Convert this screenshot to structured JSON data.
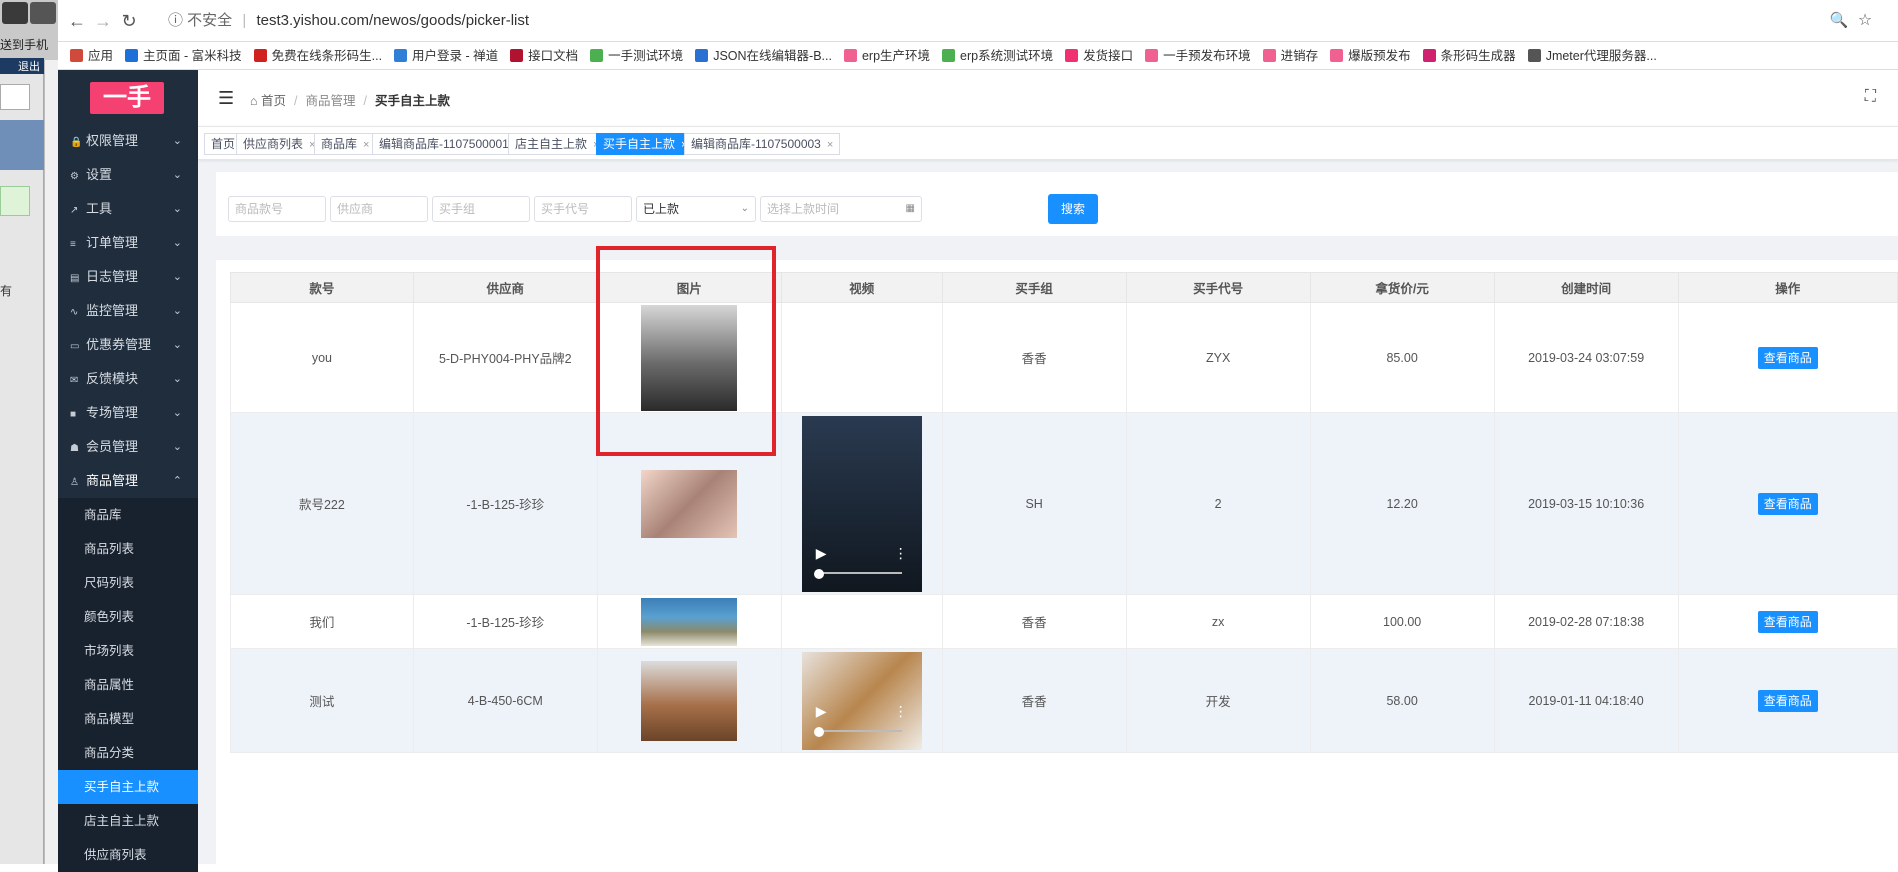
{
  "desktop": {
    "send_text": "送到手机",
    "logout": "退出",
    "side_text": "有"
  },
  "browser": {
    "insecure": "不安全",
    "url": "test3.yishou.com/newos/goods/picker-list",
    "bookmarks": [
      {
        "label": "应用",
        "color": "#d04a3c"
      },
      {
        "label": "主页面 - 富米科技",
        "color": "#1e6fd9"
      },
      {
        "label": "免费在线条形码生...",
        "color": "#d02020"
      },
      {
        "label": "用户登录 - 禅道",
        "color": "#2f7fd6"
      },
      {
        "label": "接口文档",
        "color": "#b0122f"
      },
      {
        "label": "一手测试环境",
        "color": "#4caf50"
      },
      {
        "label": "JSON在线编辑器-B...",
        "color": "#2a6fd1"
      },
      {
        "label": "erp生产环境",
        "color": "#f06090"
      },
      {
        "label": "erp系统测试环境",
        "color": "#4caf50"
      },
      {
        "label": "发货接口",
        "color": "#f03070"
      },
      {
        "label": "一手预发布环境",
        "color": "#f06090"
      },
      {
        "label": "进销存",
        "color": "#f06090"
      },
      {
        "label": "爆版预发布",
        "color": "#f06090"
      },
      {
        "label": "条形码生成器",
        "color": "#d02070"
      },
      {
        "label": "Jmeter代理服务器...",
        "color": "#555555"
      }
    ]
  },
  "app": {
    "logo": "一手",
    "menu": [
      {
        "label": "权限管理",
        "icon": "lock-icon",
        "glyph": "🔒"
      },
      {
        "label": "设置",
        "icon": "gear-icon",
        "glyph": "⚙"
      },
      {
        "label": "工具",
        "icon": "wrench-icon",
        "glyph": "↗"
      },
      {
        "label": "订单管理",
        "icon": "list-icon",
        "glyph": "≡"
      },
      {
        "label": "日志管理",
        "icon": "log-icon",
        "glyph": "▤"
      },
      {
        "label": "监控管理",
        "icon": "pulse-icon",
        "glyph": "∿"
      },
      {
        "label": "优惠券管理",
        "icon": "coupon-icon",
        "glyph": "▭"
      },
      {
        "label": "反馈模块",
        "icon": "mail-icon",
        "glyph": "✉"
      },
      {
        "label": "专场管理",
        "icon": "square-icon",
        "glyph": "■"
      },
      {
        "label": "会员管理",
        "icon": "member-icon",
        "glyph": "☗"
      }
    ],
    "open_menu": {
      "label": "商品管理",
      "icon": "bag-icon",
      "glyph": "♙"
    },
    "submenu": [
      "商品库",
      "商品列表",
      "尺码列表",
      "颜色列表",
      "市场列表",
      "商品属性",
      "商品模型",
      "商品分类",
      "买手自主上款",
      "店主自主上款",
      "供应商列表"
    ],
    "active_sub_index": 8,
    "breadcrumb": {
      "home": "首页",
      "mid": "商品管理",
      "last": "买手自主上款"
    },
    "tags": [
      {
        "label": "首页",
        "closable": false
      },
      {
        "label": "供应商列表",
        "closable": true
      },
      {
        "label": "商品库",
        "closable": true
      },
      {
        "label": "编辑商品库-1107500001",
        "closable": true
      },
      {
        "label": "店主自主上款",
        "closable": true
      },
      {
        "label": "买手自主上款",
        "closable": true,
        "active": true
      },
      {
        "label": "编辑商品库-1107500003",
        "closable": true
      }
    ],
    "filters": {
      "code_ph": "商品款号",
      "supplier_ph": "供应商",
      "group_ph": "买手组",
      "buyer_ph": "买手代号",
      "status_val": "已上款",
      "time_ph": "选择上款时间",
      "search": "搜索"
    },
    "table": {
      "headers": [
        "款号",
        "供应商",
        "图片",
        "视频",
        "买手组",
        "买手代号",
        "拿货价/元",
        "创建时间",
        "操作"
      ],
      "action_label": "查看商品",
      "rows": [
        {
          "code": "you",
          "supplier": "5-D-PHY004-PHY品牌2",
          "group": "香香",
          "buyer": "ZYX",
          "price": "85.00",
          "created": "2019-03-24 03:07:59"
        },
        {
          "code": "款号222",
          "supplier": "-1-B-125-珍珍",
          "group": "SH",
          "buyer": "2",
          "price": "12.20",
          "created": "2019-03-15 10:10:36"
        },
        {
          "code": "我们",
          "supplier": "-1-B-125-珍珍",
          "group": "香香",
          "buyer": "zx",
          "price": "100.00",
          "created": "2019-02-28 07:18:38"
        },
        {
          "code": "测试",
          "supplier": "4-B-450-6CM",
          "group": "香香",
          "buyer": "开发",
          "price": "58.00",
          "created": "2019-01-11 04:18:40"
        }
      ]
    }
  }
}
